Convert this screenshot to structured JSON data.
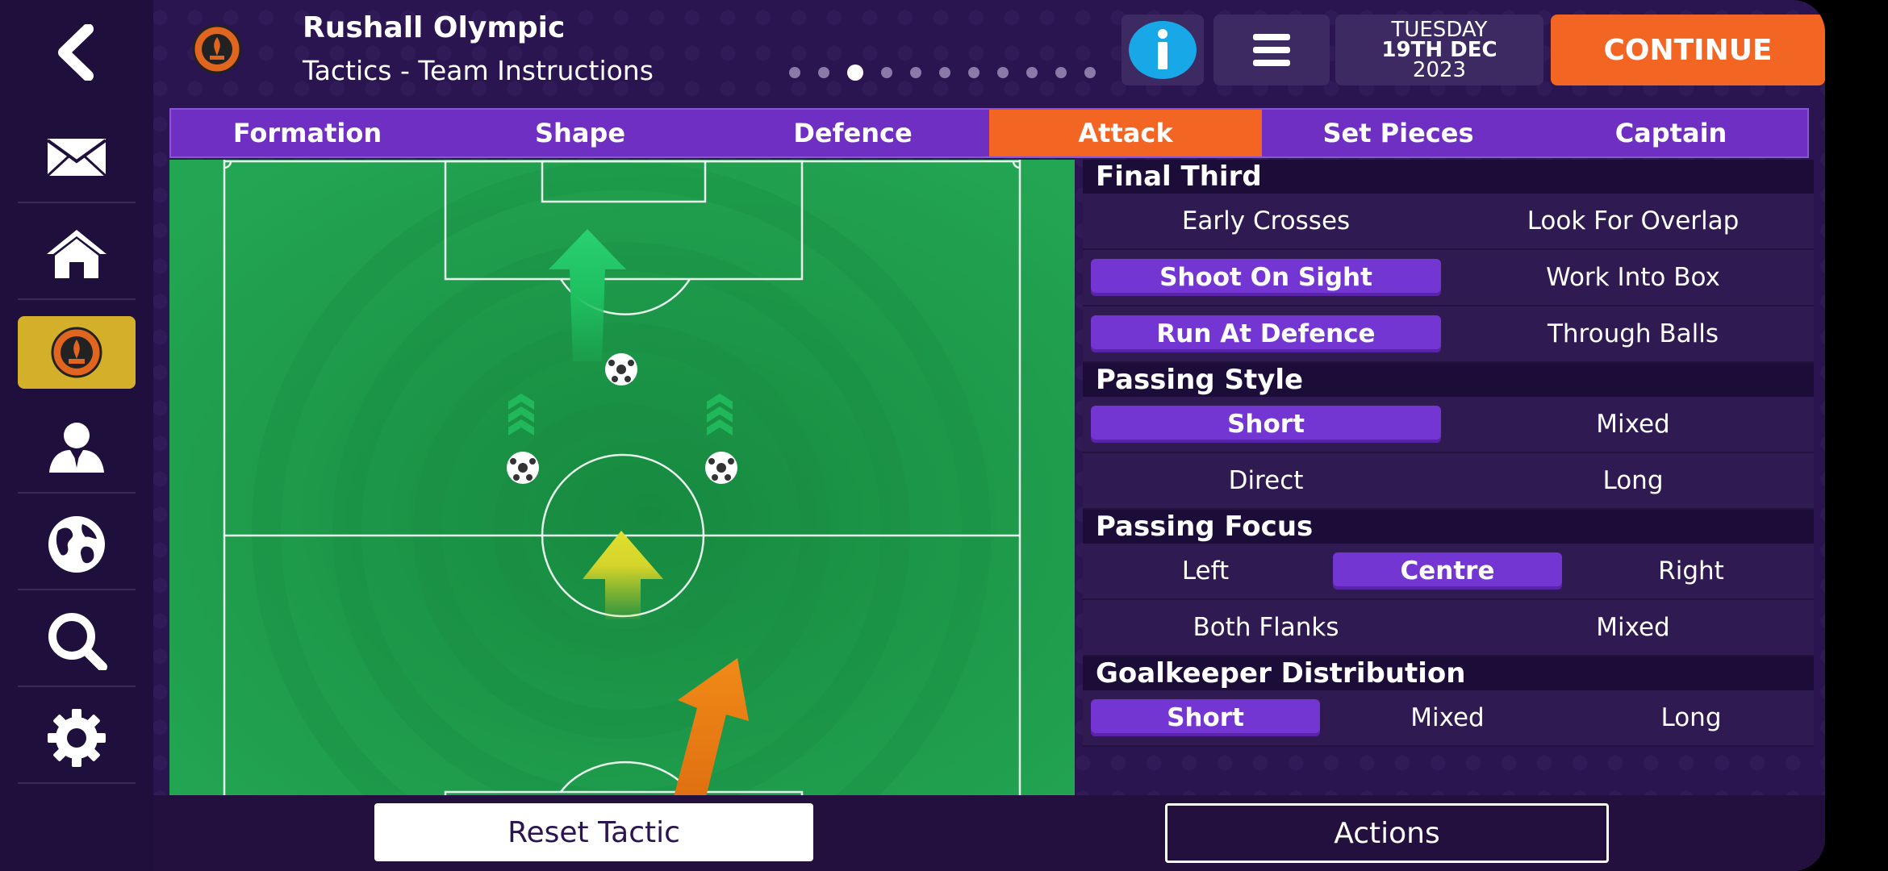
{
  "header": {
    "club_name": "Rushall Olympic",
    "screen_title": "Tactics - Team Instructions",
    "pager_total": 11,
    "pager_active": 3,
    "date_day": "TUESDAY",
    "date_date": "19TH DEC",
    "date_year": "2023",
    "continue_label": "CONTINUE"
  },
  "sidebar": {
    "items": [
      {
        "icon": "back-arrow-icon"
      },
      {
        "icon": "mail-icon"
      },
      {
        "icon": "home-icon"
      },
      {
        "icon": "club-badge-icon",
        "active": true
      },
      {
        "icon": "manager-icon"
      },
      {
        "icon": "globe-icon"
      },
      {
        "icon": "search-icon"
      },
      {
        "icon": "gear-icon"
      }
    ]
  },
  "tabs": [
    {
      "label": "Formation"
    },
    {
      "label": "Shape"
    },
    {
      "label": "Defence"
    },
    {
      "label": "Attack",
      "active": true
    },
    {
      "label": "Set Pieces"
    },
    {
      "label": "Captain"
    }
  ],
  "panel": {
    "final_third": {
      "title": "Final Third",
      "rows": [
        [
          "Early Crosses",
          "Look For Overlap"
        ],
        [
          "Shoot On Sight",
          "Work Into Box"
        ],
        [
          "Run At Defence",
          "Through Balls"
        ]
      ]
    },
    "passing_style": {
      "title": "Passing Style",
      "rows": [
        [
          "Short",
          "Mixed"
        ],
        [
          "Direct",
          "Long"
        ]
      ]
    },
    "passing_focus": {
      "title": "Passing Focus",
      "row1": [
        "Left",
        "Centre",
        "Right"
      ],
      "row2": [
        "Both Flanks",
        "Mixed"
      ]
    },
    "gk_distribution": {
      "title": "Goalkeeper Distribution",
      "row": [
        "Short",
        "Mixed",
        "Long"
      ]
    }
  },
  "footer": {
    "reset_label": "Reset Tactic",
    "actions_label": "Actions"
  },
  "colors": {
    "background": "#2a1550",
    "accent_orange": "#f26522",
    "selected_purple": "#7336d2",
    "sidebar_active": "#d4b02a",
    "pitch_green": "#1f9d4c"
  }
}
